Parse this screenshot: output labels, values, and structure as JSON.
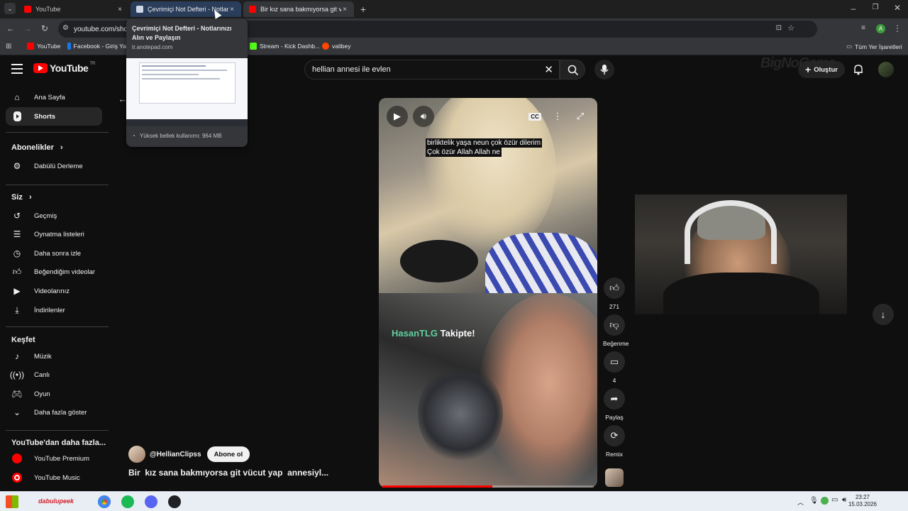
{
  "browser": {
    "tabs": [
      {
        "title": "YouTube",
        "state": "normal"
      },
      {
        "title": "Çevrimiçi Not Defteri - Notları",
        "state": "hover"
      },
      {
        "title": "Bir kız sana bakmıyorsa git vücu",
        "state": "active"
      }
    ],
    "url": "youtube.com/sho",
    "bookmarks": [
      "YouTube",
      "Facebook - Giriş Ya",
      "Stream - Kick Dashb...",
      "valibey"
    ],
    "all_bookmarks": "Tüm Yer İşaretleri",
    "profile_initial": "A"
  },
  "tooltip": {
    "title": "Çevrimiçi Not Defteri - Notlarınızı Alın ve Paylaşın",
    "url": "tr.anotepad.com",
    "memory": "Yüksek bellek kullanımı: 964 MB"
  },
  "youtube": {
    "logo": "YouTube",
    "region": "TR",
    "search_query": "hellian annesi ile evlen",
    "create_label": "Oluştur",
    "watermark": "BigNoGame"
  },
  "sidebar": {
    "main": [
      {
        "label": "Ana Sayfa",
        "icon": "home-icon"
      },
      {
        "label": "Shorts",
        "icon": "shorts-icon",
        "active": true
      }
    ],
    "subscriptions_header": "Abonelikler",
    "subscriptions": [
      {
        "label": "Dabülü Derleme",
        "icon": "channel-avatar-icon"
      }
    ],
    "you_header": "Siz",
    "you": [
      {
        "label": "Geçmiş",
        "icon": "history-icon"
      },
      {
        "label": "Oynatma listeleri",
        "icon": "playlist-icon"
      },
      {
        "label": "Daha sonra izle",
        "icon": "clock-icon"
      },
      {
        "label": "Beğendiğim videolar",
        "icon": "thumbs-up-icon"
      },
      {
        "label": "Videolarınız",
        "icon": "video-icon"
      },
      {
        "label": "İndirilenler",
        "icon": "download-icon"
      }
    ],
    "explore_header": "Keşfet",
    "explore": [
      {
        "label": "Müzik",
        "icon": "music-icon"
      },
      {
        "label": "Canlı",
        "icon": "live-icon"
      },
      {
        "label": "Oyun",
        "icon": "gaming-icon"
      },
      {
        "label": "Daha fazla göster",
        "icon": "chevron-down-icon"
      }
    ],
    "more_header": "YouTube'dan daha fazla...",
    "more": [
      {
        "label": "YouTube Premium",
        "icon": "youtube-premium-icon"
      },
      {
        "label": "YouTube Music",
        "icon": "youtube-music-icon"
      }
    ]
  },
  "short": {
    "subtitles": [
      "birliktelik yaşa neun çok özür dilerim",
      "Çok özür Allah Allah ne"
    ],
    "follow_name": "HasanTLG",
    "follow_text": "Takipte!",
    "progress": 0.52,
    "channel": "@HellianClipss",
    "subscribe_label": "Abone ol",
    "title": "Bir  kız sana bakmıyorsa git vücut yap  annesiyl...",
    "likes": "271",
    "dislike_label": "Beğenme",
    "comments": "4",
    "share_label": "Paylaş",
    "remix_label": "Remix"
  },
  "taskbar": {
    "pinned_label": "dabulupeek",
    "time": "23:27",
    "date": "15.03.2026"
  },
  "colors": {
    "yt_red": "#ff0000",
    "background": "#0f0f0f",
    "follow_accent": "#5ecf9e"
  }
}
